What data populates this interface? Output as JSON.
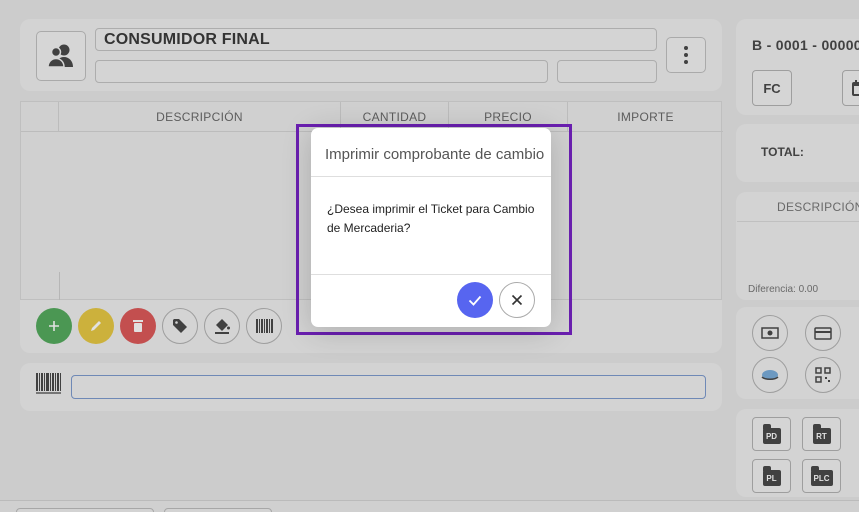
{
  "customer": {
    "name": "CONSUMIDOR FINAL",
    "avatar_icon": "users-icon",
    "more_icon": "more-vertical-icon"
  },
  "items_table": {
    "columns": [
      "DESCRIPCIÓN",
      "CANTIDAD",
      "PRECIO",
      "IMPORTE"
    ]
  },
  "action_buttons": [
    {
      "icon": "plus-icon",
      "color": "#3fa04a"
    },
    {
      "icon": "pencil-icon",
      "color": "#e4c22c"
    },
    {
      "icon": "trash-icon",
      "color": "#d94444"
    },
    {
      "icon": "tag-icon",
      "color": "#efefef"
    },
    {
      "icon": "paint-bucket-icon",
      "color": "#efefef"
    },
    {
      "icon": "barcode-icon",
      "color": "#efefef"
    }
  ],
  "scanner": {
    "icon": "barcode-scanner-icon",
    "input_value": ""
  },
  "document": {
    "number": "B - 0001 - 00000",
    "type_label": "FC",
    "calendar_icon": "calendar-icon"
  },
  "totals": {
    "total_label": "TOTAL:"
  },
  "payments": {
    "header": "DESCRIPCIÓN",
    "difference": "Diferencia: 0.00",
    "method_icons": [
      "cash-icon",
      "credit-card-icon",
      "transfer-icon",
      "qr-code-icon"
    ]
  },
  "doc_buttons": [
    "PD",
    "RT",
    "PL",
    "PLC"
  ],
  "modal": {
    "title": "Imprimir comprobante de cambio",
    "message": "¿Desea imprimir el Ticket para Cambio de Mercaderia?",
    "confirm_icon": "check-icon",
    "cancel_icon": "close-icon",
    "confirm_color": "#5765f0",
    "highlight_color": "#6a1fb0"
  }
}
